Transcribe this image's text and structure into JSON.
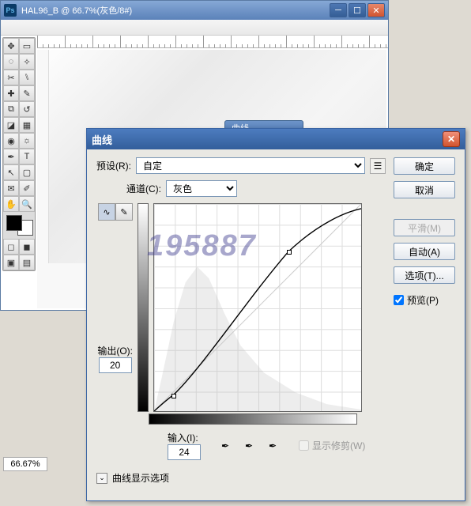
{
  "window": {
    "title": "HAL96_B @ 66.7%(灰色/8#)",
    "zoom": "66.67%"
  },
  "small_title": "曲线",
  "dialog": {
    "title": "曲线",
    "preset_label": "预设(R):",
    "preset_value": "自定",
    "channel_label": "通道(C):",
    "channel_value": "灰色",
    "output_label": "输出(O):",
    "output_value": "20",
    "input_label": "输入(I):",
    "input_value": "24",
    "show_clipping": "显示修剪(W)",
    "disclosure": "曲线显示选项",
    "buttons": {
      "ok": "确定",
      "cancel": "取消",
      "smooth": "平滑(M)",
      "auto": "自动(A)",
      "options": "选项(T)...",
      "preview": "预览(P)"
    }
  },
  "watermark": "195887",
  "chart_data": {
    "type": "line",
    "title": "曲线",
    "xlabel": "输入",
    "ylabel": "输出",
    "xlim": [
      0,
      255
    ],
    "ylim": [
      0,
      255
    ],
    "series": [
      {
        "name": "baseline",
        "x": [
          0,
          255
        ],
        "y": [
          0,
          255
        ]
      },
      {
        "name": "curve",
        "x": [
          0,
          24,
          165,
          255
        ],
        "y": [
          0,
          20,
          196,
          250
        ]
      }
    ],
    "handles": [
      {
        "x": 24,
        "y": 20
      },
      {
        "x": 165,
        "y": 196
      }
    ]
  }
}
